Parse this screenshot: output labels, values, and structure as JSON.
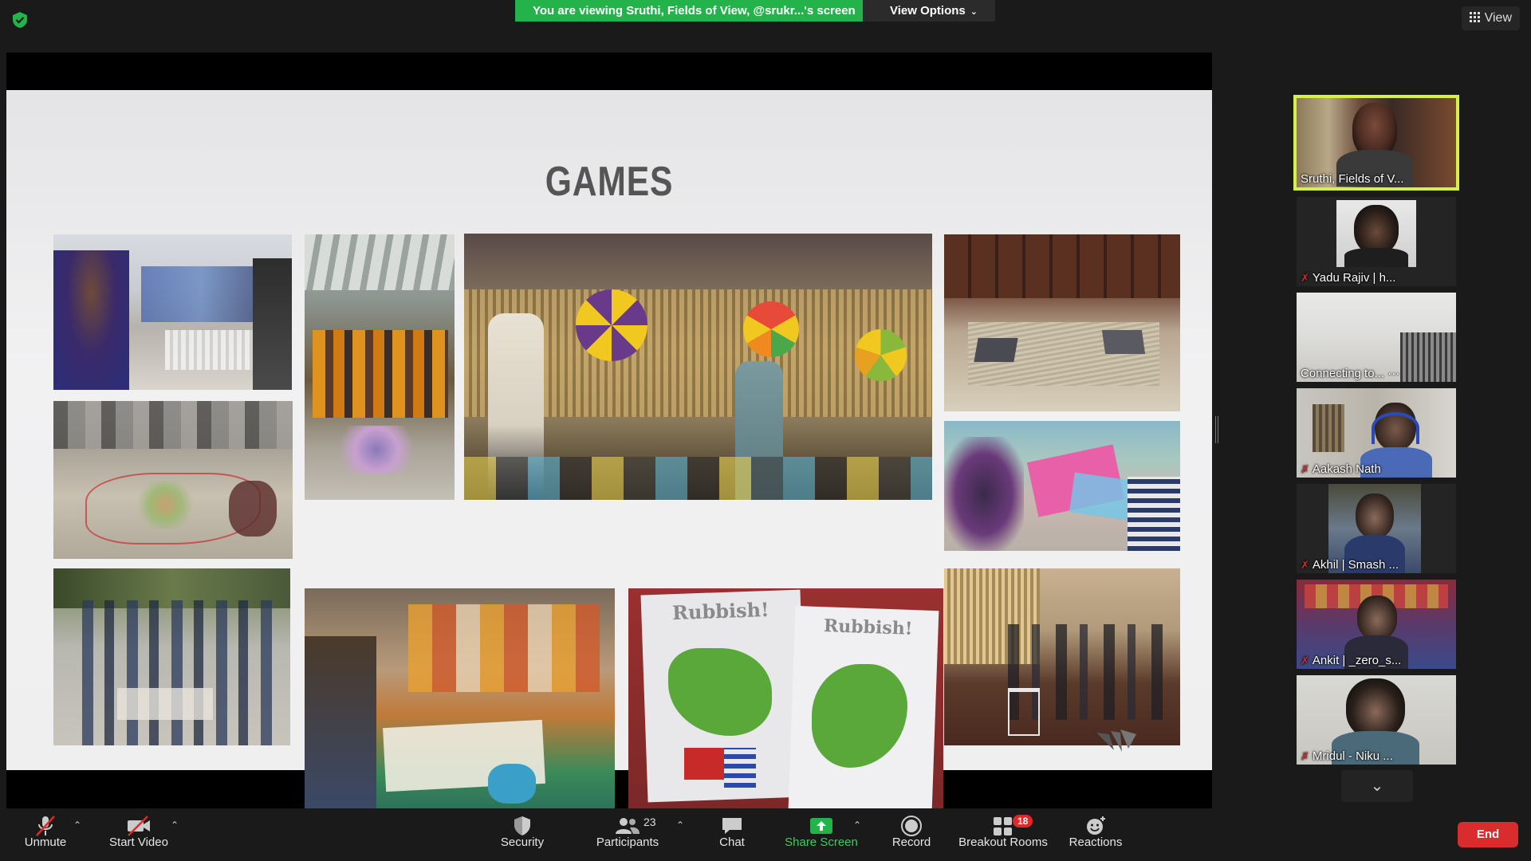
{
  "top_bar": {
    "share_banner": "You are viewing Sruthi, Fields of View, @srukr...'s screen",
    "view_options_label": "View Options",
    "view_label": "View"
  },
  "slide": {
    "title": "GAMES",
    "photos": [
      {
        "name": "photo-bottles-game",
        "label": ""
      },
      {
        "name": "photo-hall-group",
        "label": ""
      },
      {
        "name": "photo-spinning-wheel-game",
        "label": ""
      },
      {
        "name": "photo-laptops-floor",
        "label": ""
      },
      {
        "name": "photo-floor-map-game",
        "label": ""
      },
      {
        "name": "photo-pink-board-game",
        "label": ""
      },
      {
        "name": "photo-street-group",
        "label": ""
      },
      {
        "name": "photo-women-board-game",
        "label": ""
      },
      {
        "name": "photo-rubbish-game",
        "label": "Rubbish!"
      },
      {
        "name": "photo-indoor-game",
        "label": ""
      }
    ]
  },
  "participants": [
    {
      "name": "Sruthi, Fields of V...",
      "muted": false,
      "active": true
    },
    {
      "name": "Yadu Rajiv | h...",
      "muted": true,
      "active": false
    },
    {
      "name": "Connecting to... ···",
      "muted": false,
      "active": false
    },
    {
      "name": "Aakash Nath",
      "muted": true,
      "active": false
    },
    {
      "name": "Akhil | Smash ...",
      "muted": true,
      "active": false
    },
    {
      "name": "Ankit | _zero_s...",
      "muted": true,
      "active": false
    },
    {
      "name": "Mridul - Niku ...",
      "muted": true,
      "active": false
    }
  ],
  "toolbar": {
    "unmute": "Unmute",
    "start_video": "Start Video",
    "security": "Security",
    "participants": "Participants",
    "participants_count": "23",
    "chat": "Chat",
    "share_screen": "Share Screen",
    "record": "Record",
    "breakout_rooms": "Breakout Rooms",
    "breakout_badge": "18",
    "reactions": "Reactions",
    "end": "End"
  },
  "colors": {
    "banner_green": "#23b34a",
    "active_speaker": "#d6f04a",
    "end_red": "#d92c2c",
    "share_green": "#3fcb5c"
  }
}
